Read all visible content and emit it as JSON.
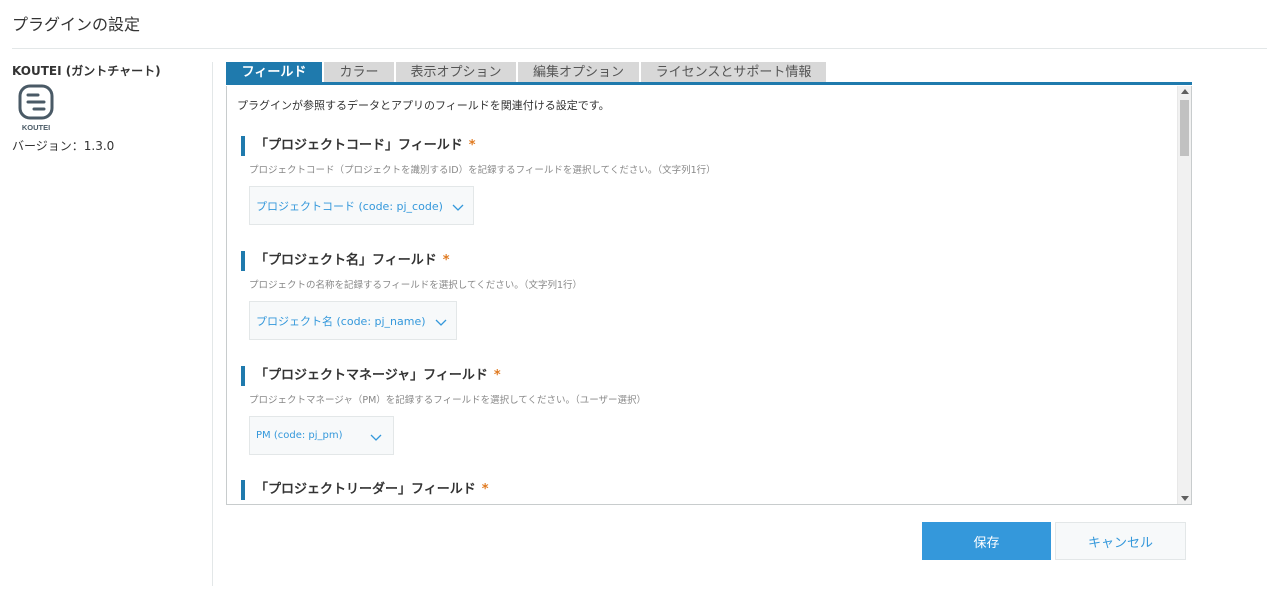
{
  "page": {
    "title": "プラグインの設定"
  },
  "plugin": {
    "name": "KOUTEI (ガントチャート)",
    "logo_text": "KOUTEI",
    "logo_icon": "koutei-logo-icon",
    "version": "バージョン：1.3.0"
  },
  "tabs": [
    {
      "label": "フィールド",
      "active": true
    },
    {
      "label": "カラー",
      "active": false
    },
    {
      "label": "表示オプション",
      "active": false
    },
    {
      "label": "編集オプション",
      "active": false
    },
    {
      "label": "ライセンスとサポート情報",
      "active": false
    }
  ],
  "panel": {
    "description": "プラグインが参照するデータとアプリのフィールドを関連付ける設定です。",
    "sections": [
      {
        "heading": "「プロジェクトコード」フィールド",
        "required": "*",
        "description": "プロジェクトコード（プロジェクトを識別するID）を記録するフィールドを選択してください。（文字列1行）",
        "selected": "プロジェクトコード (code: pj_code)"
      },
      {
        "heading": "「プロジェクト名」フィールド",
        "required": "*",
        "description": "プロジェクトの名称を記録するフィールドを選択してください。（文字列1行）",
        "selected": "プロジェクト名 (code: pj_name)"
      },
      {
        "heading": "「プロジェクトマネージャ」フィールド",
        "required": "*",
        "description": "プロジェクトマネージャ（PM）を記録するフィールドを選択してください。（ユーザー選択）",
        "selected": "PM (code: pj_pm)"
      },
      {
        "heading": "「プロジェクトリーダー」フィールド",
        "required": "*"
      }
    ]
  },
  "buttons": {
    "save": "保存",
    "cancel": "キャンセル"
  },
  "colors": {
    "accent": "#1f7aad",
    "primary_button": "#3498db",
    "required": "#e07a20"
  }
}
